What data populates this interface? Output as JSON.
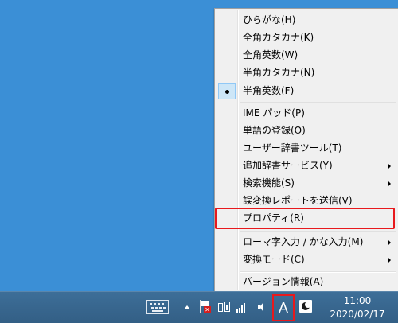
{
  "menu": {
    "items": [
      {
        "label": "ひらがな(H)",
        "checked": false,
        "submenu": false
      },
      {
        "label": "全角カタカナ(K)",
        "checked": false,
        "submenu": false
      },
      {
        "label": "全角英数(W)",
        "checked": false,
        "submenu": false
      },
      {
        "label": "半角カタカナ(N)",
        "checked": false,
        "submenu": false
      },
      {
        "label": "半角英数(F)",
        "checked": true,
        "submenu": false
      },
      {
        "label": "IME パッド(P)",
        "checked": false,
        "submenu": false
      },
      {
        "label": "単語の登録(O)",
        "checked": false,
        "submenu": false
      },
      {
        "label": "ユーザー辞書ツール(T)",
        "checked": false,
        "submenu": false
      },
      {
        "label": "追加辞書サービス(Y)",
        "checked": false,
        "submenu": true
      },
      {
        "label": "検索機能(S)",
        "checked": false,
        "submenu": true
      },
      {
        "label": "誤変換レポートを送信(V)",
        "checked": false,
        "submenu": false
      },
      {
        "label": "プロパティ(R)",
        "checked": false,
        "submenu": false
      },
      {
        "label": "ローマ字入力 / かな入力(M)",
        "checked": false,
        "submenu": true
      },
      {
        "label": "変換モード(C)",
        "checked": false,
        "submenu": true
      },
      {
        "label": "バージョン情報(A)",
        "checked": false,
        "submenu": false
      }
    ]
  },
  "taskbar": {
    "ime_mode": "A",
    "clock": {
      "time": "11:00",
      "date": "2020/02/17"
    }
  },
  "colors": {
    "desktop": "#3b8fd6",
    "highlight_border": "#e8191d",
    "menu_bg": "#f0f0f0"
  }
}
